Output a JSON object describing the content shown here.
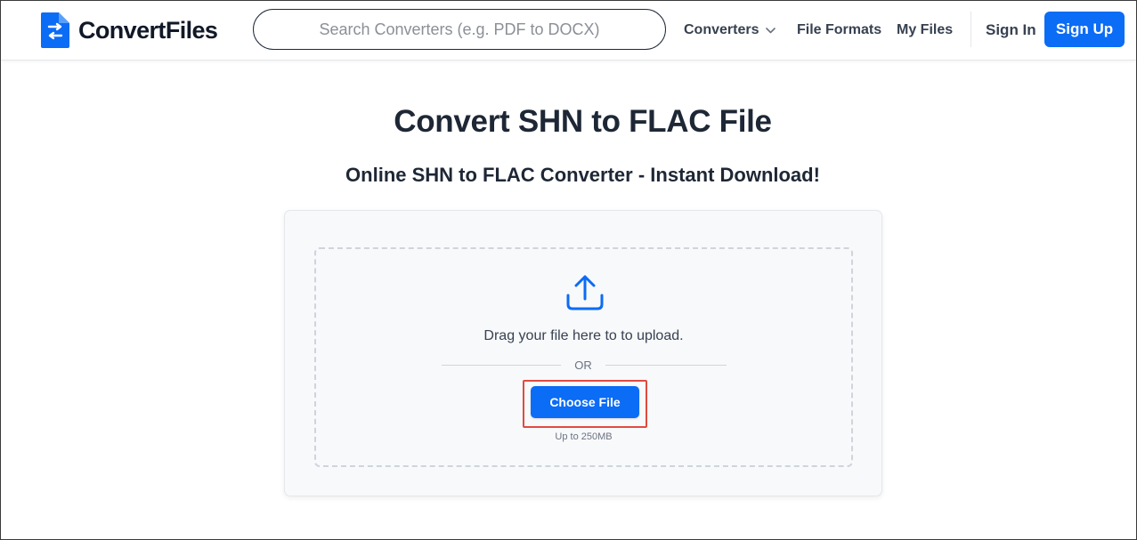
{
  "header": {
    "brand": "ConvertFiles",
    "search": {
      "placeholder": "Search Converters (e.g. PDF to DOCX)",
      "value": ""
    },
    "nav": {
      "converters": "Converters",
      "file_formats": "File Formats",
      "my_files": "My Files",
      "sign_in": "Sign In",
      "sign_up": "Sign Up"
    }
  },
  "main": {
    "title": "Convert SHN to FLAC File",
    "subtitle": "Online SHN to FLAC Converter - Instant Download!",
    "upload": {
      "drag_text": "Drag your file here to to upload.",
      "or_text": "OR",
      "choose_label": "Choose File",
      "limit_text": "Up to 250MB"
    }
  },
  "icons": {
    "logo": "convertfiles-logo-icon",
    "chevron": "chevron-down-icon",
    "upload": "upload-icon"
  },
  "colors": {
    "primary": "#0b6cf5",
    "highlight": "#e14a3f",
    "text": "#1e2735"
  }
}
